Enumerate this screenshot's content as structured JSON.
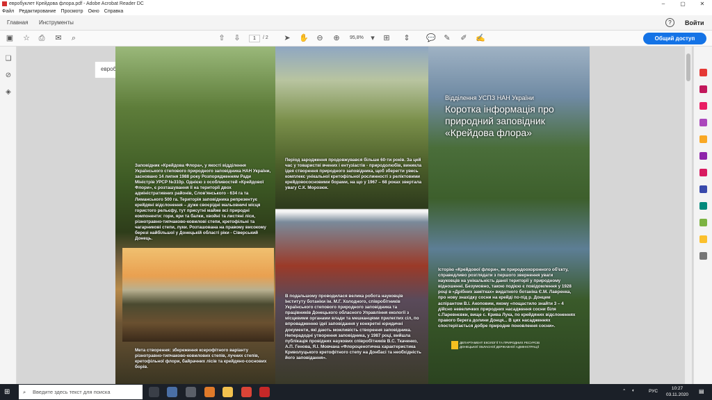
{
  "window": {
    "title": "евробуклет Крейдова флора.pdf - Adobe Acrobat Reader DC"
  },
  "menu": [
    "Файл",
    "Редактирование",
    "Просмотр",
    "Окно",
    "Справка"
  ],
  "tabs": {
    "home": "Главная",
    "tools": "Инструменты",
    "doc": "евробуклет Крейд..."
  },
  "header": {
    "login": "Войти",
    "help": "?"
  },
  "toolbar": {
    "page_current": "1",
    "page_total": "/ 2",
    "zoom": "95,8%",
    "share": "Общий доступ"
  },
  "doc": {
    "panel1_text": "Заповідник «Крейдова Флора», у якості відділення Українського степового природного заповідника НАН України, засновано 14 липня 1988 року Розпорядженням Ради Міністрів УРСР №310р. Однією з особливостей «Крейдової Флори», є розташування її на території двох адміністративних районів, Слов'янського - 634 га та Лиманського 500 га. Територія заповідника репрезентує крейдяні відслонення – дуже своєрідні мальовничі місця гористого рельєфу, тут присутні майже всі природні компоненти: гори, яри та балки, хвойні та листяні ліси, різнотравно-типчаково-ковилові степи, кретофільні та чагарникові степи, луки. Розташована на правому високому березі найбільшої у Донецькій області ріки - Сіверський Донець.",
    "panel1_text2": "Мета створення: збереження ксерофітного варіанту різнотравно-типчаково-ковилових степів, лучних степів, кретофільної флори, байрачних лісів та крейдяно-соснових борів.",
    "panel2_text": "Період зародження продовжувався більше 60-ти років. За цей час у товаристві вчених і ентузіастів - природолюбів, виникла ідея створення природного заповідника, щоб зберегти увесь комплекс унікальної кретофільної рослинності з реліктовими крейдовососновими борами, на що у 1967 – 68 роках звертала увагу С.К. Морозюк.",
    "panel2_text2": "В подальшому проводилася велика робота науковців Інституту ботаніки ім. М.Г. Холодного, співробітників Українського степового природного заповідника та працівників Донецького обласного Управління екології з місцевими органами влади та мешканцями прилеглих сіл, по впровадженню ідеї заповідання у конкретні юридичні документи, які дають можливість створення заповідника. Неперадодні утворення заповідника, у 1987 році, вийшла публікація провідних наукових співробітників В.С. Ткаченко, А.П. Генова, Я.І. Мовчана «Флороценотична характеристика Криволуцького кретофітного степу на Донбасі та необхідність його заповідання».",
    "panel3_subtitle": "Відділення УСПЗ НАН України",
    "panel3_title": "Коротка інформація про природний заповідник «Крейдова флора»",
    "panel3_text": "Історію «Крейдової флори», як природоохоронного об'єкту, справедливо розглядати з першого звернення уваги науковців на унікальність даної території у природному відношенні. Безумовно, такою подією є повідомлення у 1928 році в «Дрібних замітках» видатного ботаніка Є.М. Лавренка, про нову знахідку сосни на крейді по-під р. Донцем аспірантом В.І. Акоповим, якому «пощастило знайти 3 – 4 дійсно невеличких природних насадження сосни біля с.Паревнєвки, вище с. Крива Лука, по крейдяних відслоненнях правого берега долини Донця... В цих насадженнях спостерігається добре природне поновлення сосни».",
    "dept": "ДЕПАРТАМЕНТ ЕКОЛОГІЇ ТА ПРИРОДНИХ РЕСУРСІВ ДОНЕЦЬКОЇ ОБЛАСНОЇ ДЕРЖАВНОЇ АДМІНІСТРАЦІЇ"
  },
  "taskbar": {
    "search_placeholder": "Введите здесь текст для поиска",
    "time": "10:27",
    "date": "03.11.2020",
    "lang": "РУС"
  }
}
